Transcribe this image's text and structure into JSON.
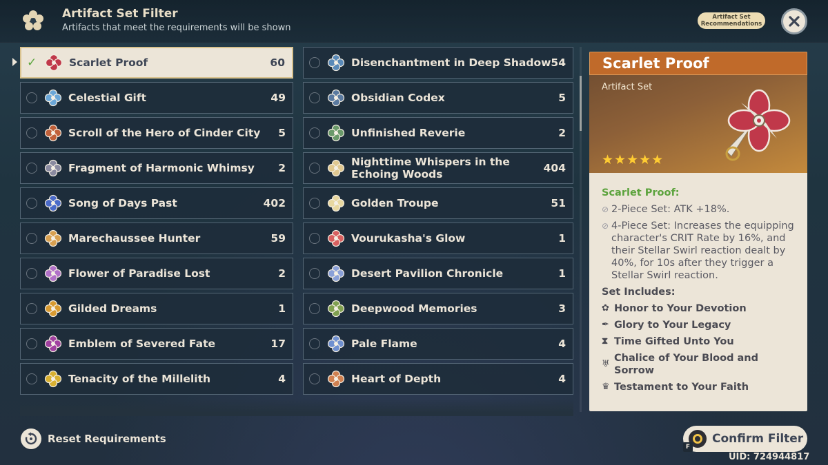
{
  "header": {
    "title": "Artifact Set Filter",
    "subtitle": "Artifacts that meet the requirements will be shown",
    "recommend_label_1": "Artifact Set",
    "recommend_label_2": "Recommendations"
  },
  "colors": {
    "accent_gold": "#d9c38f",
    "check_green": "#5aa53c",
    "set_name_green": "#5ca33d",
    "title_orange": "#c06a2a"
  },
  "left_column": [
    {
      "name": "Scarlet Proof",
      "count": "60",
      "selected": true,
      "icon": "scarlet-proof-icon",
      "color": "#c0384a"
    },
    {
      "name": "Celestial Gift",
      "count": "49",
      "icon": "celestial-gift-icon",
      "color": "#6aa7d8"
    },
    {
      "name": "Scroll of the Hero of Cinder City",
      "count": "5",
      "icon": "scroll-hero-icon",
      "color": "#c0603a"
    },
    {
      "name": "Fragment of Harmonic Whimsy",
      "count": "2",
      "icon": "fragment-whimsy-icon",
      "color": "#8a8aa0"
    },
    {
      "name": "Song of Days Past",
      "count": "402",
      "icon": "song-days-icon",
      "color": "#4a6ac8"
    },
    {
      "name": "Marechaussee Hunter",
      "count": "59",
      "icon": "marechaussee-icon",
      "color": "#d8a050"
    },
    {
      "name": "Flower of Paradise Lost",
      "count": "2",
      "icon": "flower-paradise-icon",
      "color": "#b070c8"
    },
    {
      "name": "Gilded Dreams",
      "count": "1",
      "icon": "gilded-dreams-icon",
      "color": "#d89a30"
    },
    {
      "name": "Emblem of Severed Fate",
      "count": "17",
      "icon": "emblem-fate-icon",
      "color": "#a040a0"
    },
    {
      "name": "Tenacity of the Millelith",
      "count": "4",
      "icon": "tenacity-icon",
      "color": "#d8b030"
    }
  ],
  "right_column": [
    {
      "name": "Disenchantment in Deep Shadow",
      "count": "54",
      "icon": "disenchantment-icon",
      "color": "#5a8ab8"
    },
    {
      "name": "Obsidian Codex",
      "count": "5",
      "icon": "obsidian-codex-icon",
      "color": "#5a7aa0"
    },
    {
      "name": "Unfinished Reverie",
      "count": "2",
      "icon": "unfinished-reverie-icon",
      "color": "#6a9a6a"
    },
    {
      "name": "Nighttime Whispers in the Echoing Woods",
      "count": "404",
      "icon": "nighttime-whispers-icon",
      "color": "#e0c890"
    },
    {
      "name": "Golden Troupe",
      "count": "51",
      "icon": "golden-troupe-icon",
      "color": "#e8d8a0"
    },
    {
      "name": "Vourukasha's Glow",
      "count": "1",
      "icon": "vourukasha-icon",
      "color": "#d86060"
    },
    {
      "name": "Desert Pavilion Chronicle",
      "count": "1",
      "icon": "desert-pavilion-icon",
      "color": "#8aa0d8"
    },
    {
      "name": "Deepwood Memories",
      "count": "3",
      "icon": "deepwood-icon",
      "color": "#80a050"
    },
    {
      "name": "Pale Flame",
      "count": "4",
      "icon": "pale-flame-icon",
      "color": "#7090d0"
    },
    {
      "name": "Heart of Depth",
      "count": "4",
      "icon": "heart-depth-icon",
      "color": "#d08050"
    }
  ],
  "detail": {
    "name": "Scarlet Proof",
    "type": "Artifact Set",
    "stars": "★★★★★",
    "set_label": "Scarlet Proof:",
    "bonus_2": "2-Piece Set: ATK +18%.",
    "bonus_4": "4-Piece Set: Increases the equipping character's CRIT Rate by 16%, and their Stellar Swirl reaction dealt by 40%, for 10s after they trigger a Stellar Swirl reaction.",
    "includes_title": "Set Includes:",
    "pieces": [
      {
        "name": "Honor to Your Devotion",
        "icon": "flower-icon",
        "glyph": "✿"
      },
      {
        "name": "Glory to Your Legacy",
        "icon": "plume-icon",
        "glyph": "✒"
      },
      {
        "name": "Time Gifted Unto You",
        "icon": "sands-icon",
        "glyph": "⧗"
      },
      {
        "name": "Chalice of Your Blood and Sorrow",
        "icon": "goblet-icon",
        "glyph": "♅"
      },
      {
        "name": "Testament to Your Faith",
        "icon": "circlet-icon",
        "glyph": "♛"
      }
    ]
  },
  "footer": {
    "reset_label": "Reset Requirements",
    "confirm_label": "Confirm Filter",
    "confirm_key": "F",
    "uid": "UID: 724944817"
  }
}
